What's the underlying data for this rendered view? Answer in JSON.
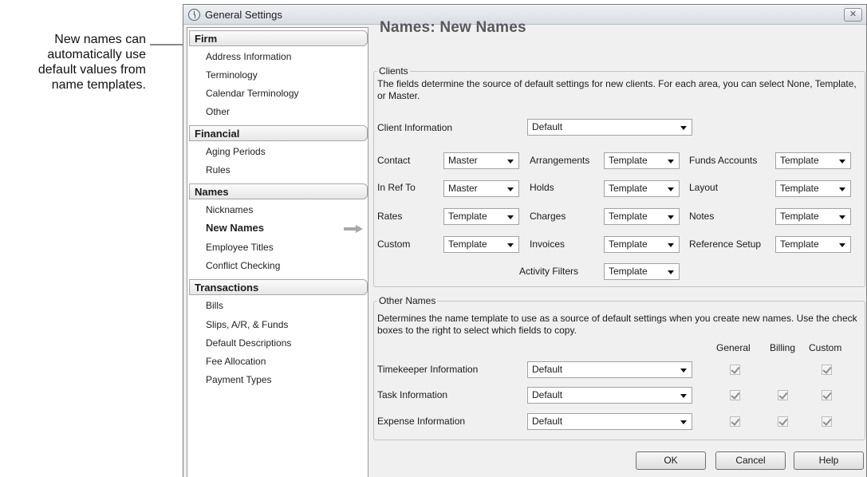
{
  "callout": {
    "lines": [
      "New names can",
      "automatically use",
      "default values from",
      "name templates."
    ]
  },
  "window": {
    "title": "General Settings",
    "close_glyph": "✕"
  },
  "sidebar": {
    "groups": [
      {
        "label": "Firm",
        "items": [
          "Address Information",
          "Terminology",
          "Calendar Terminology",
          "Other"
        ]
      },
      {
        "label": "Financial",
        "items": [
          "Aging Periods",
          "Rules"
        ]
      },
      {
        "label": "Names",
        "items": [
          "Nicknames",
          "New Names",
          "Employee Titles",
          "Conflict Checking"
        ]
      },
      {
        "label": "Transactions",
        "items": [
          "Bills",
          "Slips, A/R, & Funds",
          "Default Descriptions",
          "Fee Allocation",
          "Payment Types"
        ]
      }
    ],
    "selected": "New Names"
  },
  "main": {
    "title": "Names: New Names",
    "clients": {
      "legend": "Clients",
      "description": "The fields determine the source of default settings for new clients. For each area, you can select None, Template, or Master.",
      "client_info": {
        "label": "Client Information",
        "value": "Default"
      },
      "fields": [
        {
          "label": "Contact",
          "value": "Master"
        },
        {
          "label": "Arrangements",
          "value": "Template"
        },
        {
          "label": "Funds Accounts",
          "value": "Template"
        },
        {
          "label": "In Ref To",
          "value": "Master"
        },
        {
          "label": "Holds",
          "value": "Template"
        },
        {
          "label": "Layout",
          "value": "Template"
        },
        {
          "label": "Rates",
          "value": "Template"
        },
        {
          "label": "Charges",
          "value": "Template"
        },
        {
          "label": "Notes",
          "value": "Template"
        },
        {
          "label": "Custom",
          "value": "Template"
        },
        {
          "label": "Invoices",
          "value": "Template"
        },
        {
          "label": "Reference Setup",
          "value": "Template"
        },
        {
          "label": "Activity Filters",
          "value": "Template"
        }
      ]
    },
    "other_names": {
      "legend": "Other Names",
      "description": "Determines the name template to use as a source of default settings when you create new names. Use the check boxes to the right to select which fields to copy.",
      "columns": [
        "General",
        "Billing",
        "Custom"
      ],
      "rows": [
        {
          "label": "Timekeeper Information",
          "value": "Default",
          "general": true,
          "billing": null,
          "custom": true
        },
        {
          "label": "Task Information",
          "value": "Default",
          "general": true,
          "billing": true,
          "custom": true
        },
        {
          "label": "Expense Information",
          "value": "Default",
          "general": true,
          "billing": true,
          "custom": true
        }
      ]
    },
    "buttons": {
      "ok": "OK",
      "cancel": "Cancel",
      "help": "Help"
    }
  }
}
